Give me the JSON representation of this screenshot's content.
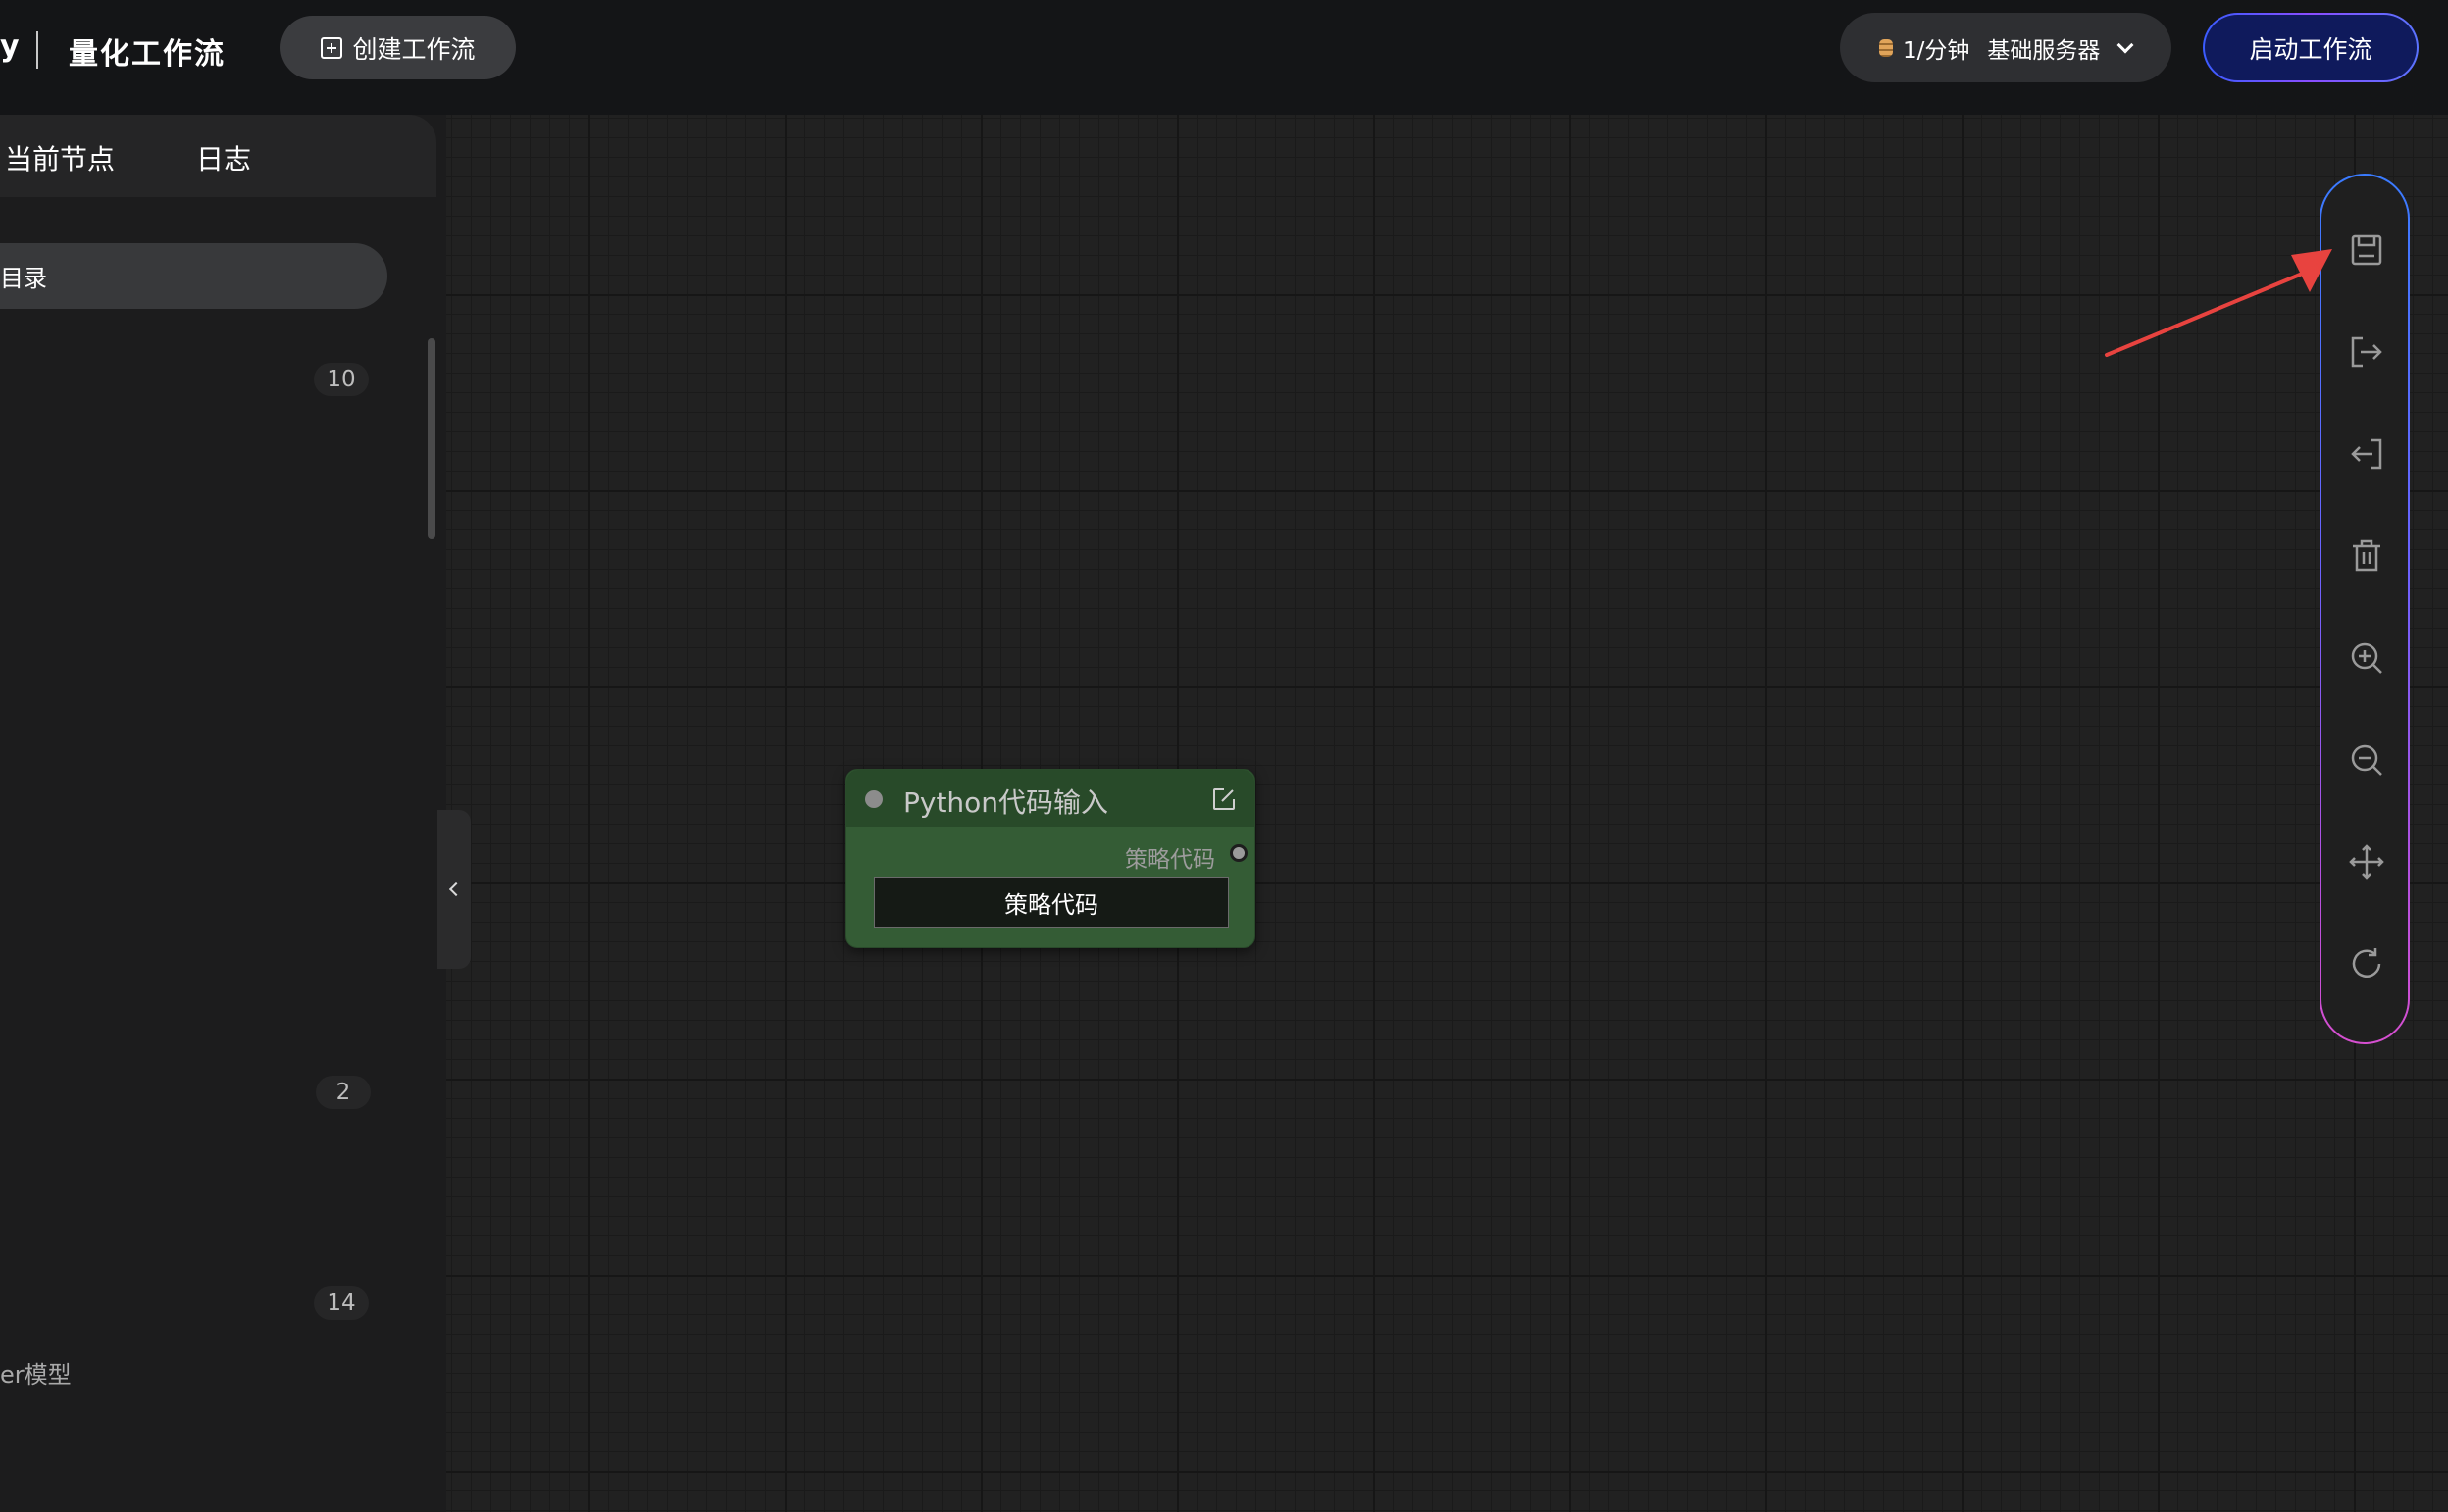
{
  "header": {
    "brand_tail": "y",
    "title": "量化工作流",
    "create_label": "创建工作流",
    "rate": "1/分钟",
    "server": "基础服务器",
    "start_label": "启动工作流"
  },
  "panel": {
    "tab_current": "当前节点",
    "tab_log": "日志",
    "dir_label": "目录",
    "count_1": "10",
    "count_2": "2",
    "count_3": "14",
    "model_item": "er模型"
  },
  "node": {
    "title": "Python代码输入",
    "output_label": "策略代码",
    "field_value": "策略代码"
  },
  "toolbar": {
    "icons": [
      "save-icon",
      "export-icon",
      "import-icon",
      "delete-icon",
      "zoom-in-icon",
      "zoom-out-icon",
      "move-icon",
      "refresh-icon"
    ]
  },
  "colors": {
    "node_green": "#345c35",
    "toolbar_gradient": [
      "#3a7bff",
      "#d64fd0"
    ],
    "annotation_arrow": "#e8433f"
  }
}
